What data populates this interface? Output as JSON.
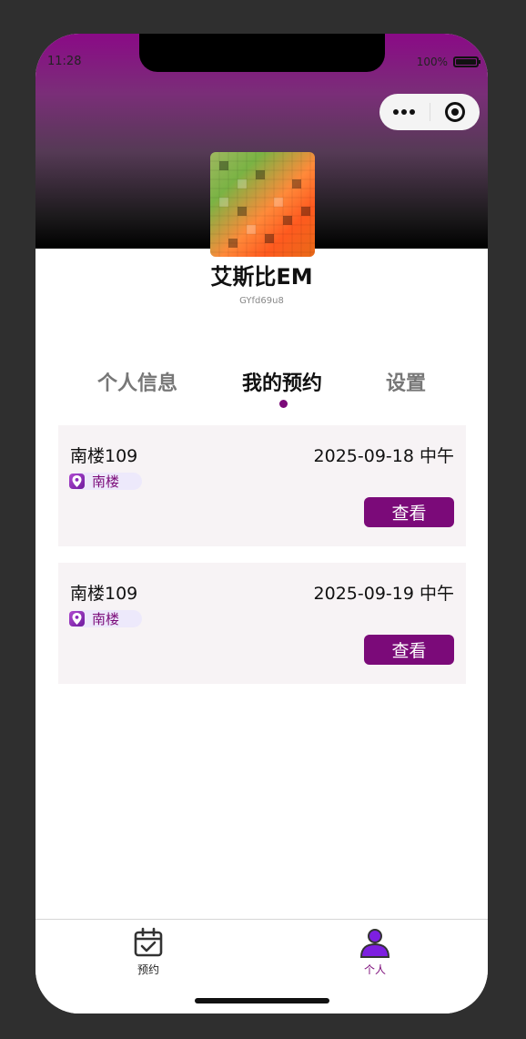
{
  "status_bar": {
    "time": "11:28",
    "battery": "100%"
  },
  "capsule": {
    "more_icon": "more-dots-icon",
    "close_icon": "target-circle-icon"
  },
  "profile": {
    "name": "艾斯比EM",
    "uid": "GYfd69u8"
  },
  "tabs": [
    {
      "label": "个人信息",
      "active": false
    },
    {
      "label": "我的预约",
      "active": true
    },
    {
      "label": "设置",
      "active": false
    }
  ],
  "bookings": [
    {
      "room": "南楼109",
      "date": "2025-09-18 中午",
      "building": "南楼",
      "button": "查看"
    },
    {
      "room": "南楼109",
      "date": "2025-09-19 中午",
      "building": "南楼",
      "button": "查看"
    }
  ],
  "tabbar": [
    {
      "label": "预约",
      "icon": "calendar-check-icon",
      "active": false
    },
    {
      "label": "个人",
      "icon": "person-icon",
      "active": true
    }
  ],
  "colors": {
    "accent": "#7b0a79",
    "card_bg": "#f7f3f5",
    "tag_bg": "#ede9fb"
  }
}
